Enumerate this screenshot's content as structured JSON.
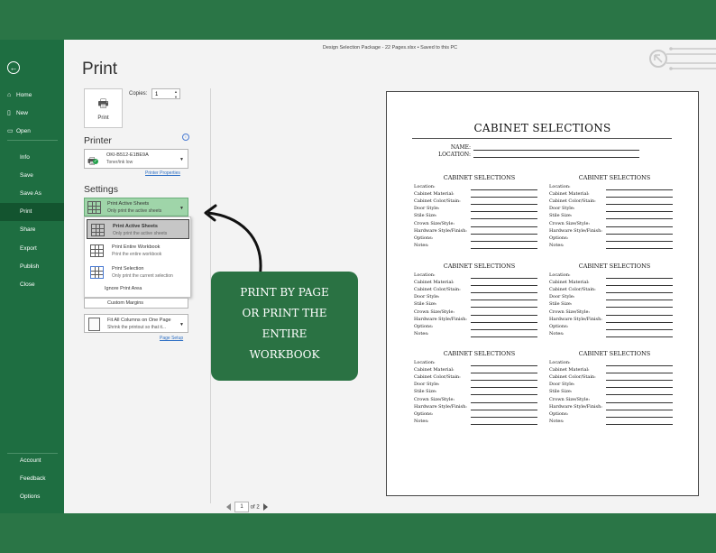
{
  "window": {
    "title": "Design Selection Package - 22 Pages.xlsx  •  Saved to this PC"
  },
  "sidebar": {
    "items": [
      {
        "label": "Home",
        "icon": "home-icon",
        "glyph": "⌂"
      },
      {
        "label": "New",
        "icon": "new-file-icon",
        "glyph": "▯"
      },
      {
        "label": "Open",
        "icon": "folder-icon",
        "glyph": "▭"
      },
      {
        "label": "Info"
      },
      {
        "label": "Save"
      },
      {
        "label": "Save As"
      },
      {
        "label": "Print"
      },
      {
        "label": "Share"
      },
      {
        "label": "Export"
      },
      {
        "label": "Publish"
      },
      {
        "label": "Close"
      }
    ],
    "bottom_items": [
      {
        "label": "Account"
      },
      {
        "label": "Feedback"
      },
      {
        "label": "Options"
      }
    ],
    "active": "Print"
  },
  "print": {
    "title": "Print",
    "button_label": "Print",
    "copies_label": "Copies:",
    "copies_value": "1"
  },
  "printer": {
    "section_title": "Printer",
    "name": "OKI-B512-E1BE9A",
    "status": "Toner/ink low",
    "properties_link": "Printer Properties"
  },
  "settings": {
    "section_title": "Settings",
    "selected": {
      "title": "Print Active Sheets",
      "subtitle": "Only print the active sheets"
    },
    "options": [
      {
        "title": "Print Active Sheets",
        "subtitle": "Only print the active sheets"
      },
      {
        "title": "Print Entire Workbook",
        "subtitle": "Print the entire workbook"
      },
      {
        "title": "Print Selection",
        "subtitle": "Only print the current selection"
      }
    ],
    "ignore_print_area": "Ignore Print Area",
    "margins": "Custom Margins",
    "scaling_title": "Fit All Columns on One Page",
    "scaling_subtitle": "Shrink the printout so that it...",
    "page_setup_link": "Page Setup"
  },
  "pager": {
    "current": "1",
    "of_label": "of 2"
  },
  "callout": {
    "text": [
      "PRINT BY PAGE",
      "OR PRINT THE",
      "ENTIRE",
      "WORKBOOK"
    ]
  },
  "sheet": {
    "title": "CABINET SELECTIONS",
    "name_label": "NAME:",
    "location_label": "LOCATION:",
    "block_title": "CABINET SELECTIONS",
    "fields": [
      "Location:",
      "Cabinet Material:",
      "Cabinet Color/Stain:",
      "Door Style:",
      "Stile Size:",
      "Crown Size/Style:",
      "Hardware Style/Finish:",
      "Options:",
      "Notes:"
    ]
  },
  "colors": {
    "excel_green": "#217346",
    "active_nav": "#13542f",
    "selected_dropdown": "#9fd5a9",
    "callout_bg": "#2a7243"
  }
}
